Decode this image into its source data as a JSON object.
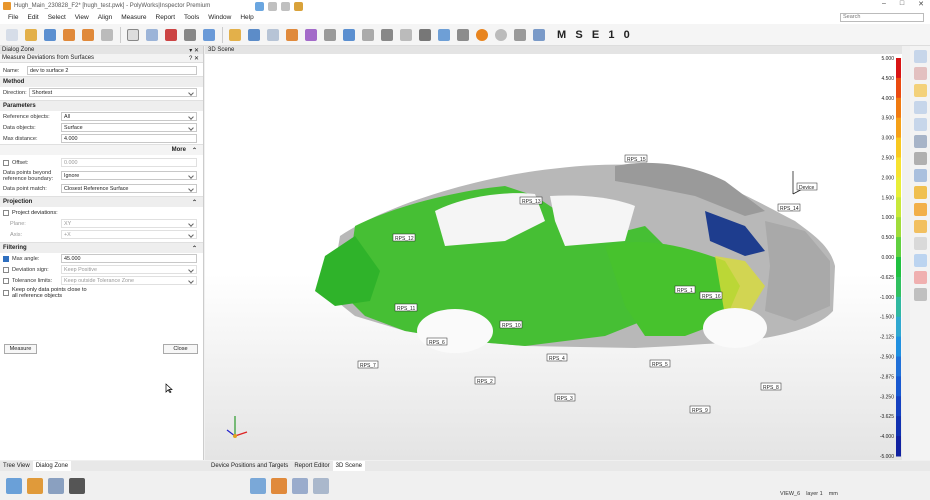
{
  "window": {
    "title": "Hugh_Main_230828_F2* [hugh_test.pwk] - PolyWorks|Inspector Premium",
    "search_placeholder": "Search"
  },
  "menu": [
    "File",
    "Edit",
    "Select",
    "View",
    "Align",
    "Measure",
    "Report",
    "Tools",
    "Window",
    "Help"
  ],
  "toolbar": {
    "mode_letters": [
      "M",
      "S",
      "E",
      "1",
      "0"
    ]
  },
  "dialog": {
    "zone_title": "Dialog Zone",
    "panel_title": "Measure Deviations from Surfaces",
    "name_label": "Name:",
    "name_value": "dev to surface 2",
    "method": {
      "title": "Method",
      "direction_label": "Direction:",
      "direction_value": "Shortest"
    },
    "parameters": {
      "title": "Parameters",
      "ref_label": "Reference objects:",
      "ref_value": "All",
      "data_label": "Data objects:",
      "data_value": "Surface",
      "maxdist_label": "Max distance:",
      "maxdist_value": "4.000",
      "more": "More"
    },
    "offset_label": "Offset:",
    "offset_value": "0.000",
    "beyond_label": "Data points beyond reference boundary:",
    "beyond_value": "Ignore",
    "match_label": "Data point match:",
    "match_value": "Closest Reference Surface",
    "projection": {
      "title": "Projection",
      "project_label": "Project deviations:",
      "plane_label": "Plane:",
      "plane_value": "XY",
      "axis_label": "Axis:",
      "axis_value": "+X"
    },
    "filtering": {
      "title": "Filtering",
      "maxangle_label": "Max angle:",
      "maxangle_value": "45.000",
      "devsign_label": "Deviation sign:",
      "devsign_value": "Keep Positive",
      "tol_label": "Tolerance limits:",
      "tol_value": "Keep outside Tolerance Zone",
      "keep_label": "Keep only data points close to all reference objects"
    },
    "measure_button": "Measure",
    "close_button": "Close"
  },
  "scene": {
    "title": "3D Scene",
    "scale": [
      "5.000",
      "4.500",
      "4.000",
      "3.500",
      "3.000",
      "2.500",
      "2.000",
      "1.500",
      "1.000",
      "0.500",
      "0.000",
      "-0.625",
      "-1.000",
      "-1.500",
      "-2.125",
      "-2.500",
      "-2.875",
      "-3.250",
      "-3.625",
      "-4.000",
      "-5.000"
    ],
    "scale_colors": [
      "#d81414",
      "#ea4a10",
      "#f07a10",
      "#f5a018",
      "#f8c820",
      "#f7e230",
      "#e8ee38",
      "#c8e83a",
      "#a0dc3a",
      "#60d040",
      "#20c040",
      "#30c060",
      "#30b8a0",
      "#30a8d0",
      "#2090e0",
      "#2070d8",
      "#1858d0",
      "#1440c0",
      "#1030b0",
      "#1020a0",
      "#101890"
    ],
    "labels": [
      "RPS_1",
      "RPS_2",
      "RPS_3",
      "RPS_4",
      "RPS_5",
      "RPS_6",
      "RPS_7",
      "RPS_8",
      "RPS_9",
      "RPS_10",
      "RPS_11",
      "RPS_12",
      "RPS_13",
      "RPS_14",
      "RPS_15",
      "RPS_16"
    ],
    "device_label": "Device"
  },
  "tabs_left": [
    "Tree View",
    "Dialog Zone"
  ],
  "tabs_scene": [
    "Device Positions and Targets",
    "Report Editor",
    "3D Scene"
  ],
  "status": {
    "view": "VIEW_6",
    "layer": "layer 1",
    "units": "mm"
  }
}
